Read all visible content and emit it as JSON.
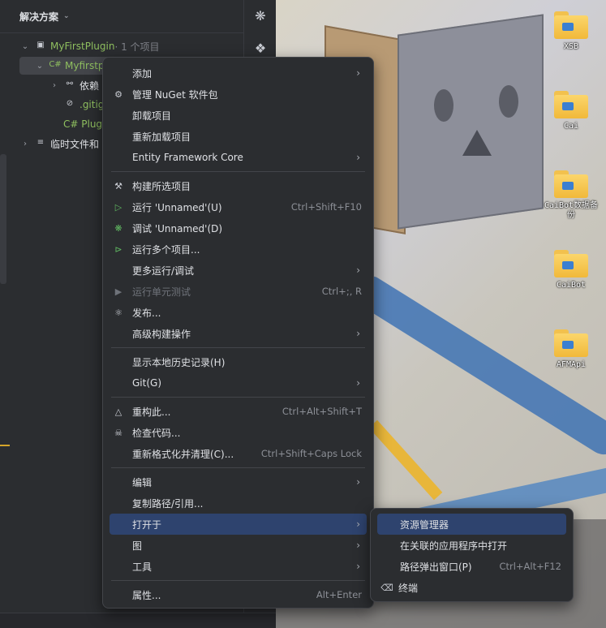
{
  "solution_panel": {
    "title": "解决方案",
    "tree": [
      {
        "label": "MyFirstPlugin",
        "suffix": " · 1 个项目"
      },
      {
        "label": "Myfirstp"
      },
      {
        "label": "依赖"
      },
      {
        "label": ".gitig"
      },
      {
        "label": "C# Plug"
      },
      {
        "label": "临时文件和"
      }
    ]
  },
  "desktop": {
    "icons": [
      {
        "label": "XSB"
      },
      {
        "label": "Cai"
      },
      {
        "label": "CaiBot数据备份"
      },
      {
        "label": "CaiBot"
      },
      {
        "label": "AFMApi"
      }
    ]
  },
  "context_menu": {
    "items": {
      "add": "添加",
      "nuget": "管理 NuGet 软件包",
      "unload": "卸载项目",
      "reload": "重新加载项目",
      "ef": "Entity Framework Core",
      "build": "构建所选项目",
      "run": "运行 'Unnamed'(U)",
      "run_short": "Ctrl+Shift+F10",
      "debug": "调试 'Unnamed'(D)",
      "run_multi": "运行多个项目...",
      "more_run": "更多运行/调试",
      "unit_test": "运行单元测试",
      "unit_test_short": "Ctrl+;, R",
      "publish": "发布...",
      "advanced_build": "高级构建操作",
      "history": "显示本地历史记录(H)",
      "git": "Git(G)",
      "refactor": "重构此...",
      "refactor_short": "Ctrl+Alt+Shift+T",
      "inspect": "检查代码...",
      "reformat": "重新格式化并清理(C)...",
      "reformat_short": "Ctrl+Shift+Caps Lock",
      "edit": "编辑",
      "copy_path": "复制路径/引用...",
      "open_in": "打开于",
      "diagram": "图",
      "tools": "工具",
      "properties": "属性...",
      "properties_short": "Alt+Enter"
    }
  },
  "submenu": {
    "explorer": "资源管理器",
    "open_assoc": "在关联的应用程序中打开",
    "path_popup": "路径弹出窗口(P)",
    "path_popup_short": "Ctrl+Alt+F12",
    "terminal": "终端"
  },
  "colors": {
    "menu_bg": "#2b2d30",
    "active_item": "#2e436e",
    "accent_green": "#8fbf5f"
  }
}
